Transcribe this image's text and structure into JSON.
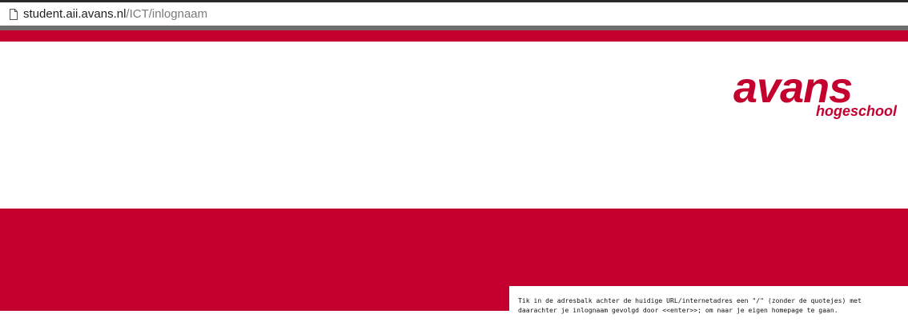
{
  "browser": {
    "url_host": "student.aii.avans.nl",
    "url_path": "/ICT/inlognaam",
    "page_icon": "page-icon"
  },
  "colors": {
    "brand_red": "#c4002f",
    "url_host": "#1e1e1e",
    "url_path": "#7a7a7a",
    "separator_grey": "#6e6e6e"
  },
  "logo": {
    "word": "avans",
    "tagline": "hogeschool"
  },
  "instructions": {
    "line1": "Tik in de adresbalk achter de huidige URL/internetadres een \"/\" (zonder de quotejes) met",
    "line2": "daarachter je inlognaam gevolgd door <<enter>>; om naar je eigen homepage te gaan."
  }
}
